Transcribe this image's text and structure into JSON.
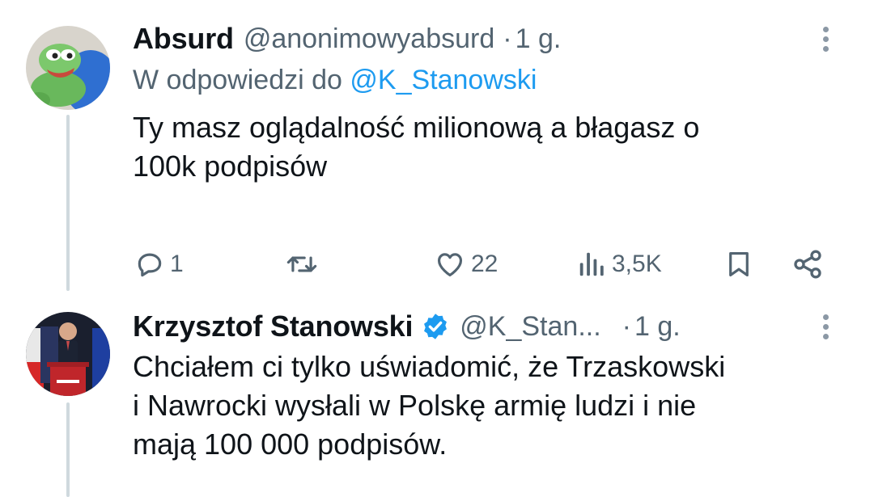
{
  "tweets": [
    {
      "name": "Absurd",
      "handle": "@anonimowyabsurd",
      "separator": "·",
      "time": "1 g.",
      "reply_prefix": "W odpowiedzi do ",
      "reply_mention": "@K_Stanowski",
      "text_line1": "Ty masz oglądalność milionową a błagasz o",
      "text_line2": "100k podpisów",
      "actions": {
        "replies": "1",
        "retweets": "",
        "likes": "22",
        "views": "3,5K"
      }
    },
    {
      "name": "Krzysztof Stanowski",
      "handle": "@K_Stan...",
      "separator": "·",
      "time": "1 g.",
      "text_line1": "Chciałem ci tylko uświadomić, że Trzaskowski",
      "text_line2": "i Nawrocki wysłali w Polskę armię ludzi i nie",
      "text_line3": "mają 100 000 podpisów."
    }
  ],
  "icons": {
    "reply": "reply-icon",
    "retweet": "retweet-icon",
    "like": "heart-icon",
    "views": "views-icon",
    "bookmark": "bookmark-icon",
    "share": "share-icon",
    "verified": "verified-badge-icon",
    "more": "more-options-icon"
  },
  "colors": {
    "accent": "#1d9bf0",
    "secondary_text": "#536471",
    "thread_line": "#cfd9de"
  }
}
